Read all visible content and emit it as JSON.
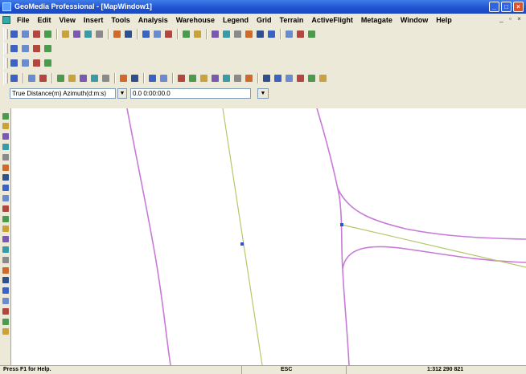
{
  "window": {
    "title": "GeoMedia Professional - [MapWindow1]",
    "controls": {
      "minimize": "_",
      "maximize": "□",
      "close": "×"
    }
  },
  "menu": {
    "items": [
      "File",
      "Edit",
      "View",
      "Insert",
      "Tools",
      "Analysis",
      "Warehouse",
      "Legend",
      "Grid",
      "Terrain",
      "ActiveFlight",
      "Metagate",
      "Window",
      "Help"
    ],
    "mdi_controls": {
      "minimize": "_",
      "restore": "▫",
      "close": "×"
    }
  },
  "measure": {
    "mode_value": "True Distance(m) Azimuth(d:m:s)",
    "coord_value": "0.0  0:00:00.0",
    "dropdown_arrow": "▼"
  },
  "status": {
    "help_text": "Press F1 for Help.",
    "esc_text": "ESC",
    "scale_text": "1:312 290 821"
  },
  "colors": {
    "road_purple": "#c77bd6",
    "line_yellow": "#b8c66a",
    "vertex_blue": "#2b55c8",
    "titlebar_blue": "#1e52d0"
  },
  "icons": {
    "toolbar_row1": [
      "new-icon",
      "open-icon",
      "save-icon",
      "print-icon",
      "cut-icon",
      "copy-icon",
      "paste-icon",
      "delete-icon",
      "undo-icon",
      "redo-icon",
      "select-tool-icon",
      "select-set-icon",
      "legend-icon",
      "layer-icon",
      "warehouse-icon",
      "zoom-in-icon",
      "zoom-out-icon",
      "fit-all-icon",
      "pan-icon",
      "refresh-icon",
      "overview-icon",
      "properties-icon",
      "magnifier-icon",
      "help-pointer-icon"
    ],
    "toolbar_row2": [
      "digitize-icon",
      "insert-icon",
      "edit-icon",
      "feature-icon"
    ],
    "toolbar_row3": [
      "grid-icon",
      "label-icon",
      "surface-icon",
      "tool-icon"
    ],
    "toolbar_row4": [
      "pointer-icon",
      "select-icon",
      "select-all-icon",
      "edit-geom-icon",
      "table-icon",
      "filter-icon",
      "analyze-icon",
      "measure-icon",
      "curve-icon",
      "trace-icon",
      "chart-icon",
      "snap-icon",
      "line-icon",
      "polyline-icon",
      "polygon-icon",
      "offset-icon",
      "arc-icon",
      "trim-icon",
      "extend-icon",
      "split-icon",
      "intersect-icon",
      "curve-fit-icon",
      "circle-icon",
      "point-icon",
      "rectangle-icon"
    ],
    "left_tools": [
      "line-tool-icon",
      "text-tool-icon",
      "rotate-icon",
      "scale-icon",
      "move-icon",
      "copy-feature-icon",
      "mirror-icon",
      "array-icon",
      "parallel-icon",
      "perpendicular-icon",
      "chamfer-icon",
      "fillet-icon",
      "merge-icon",
      "break-icon",
      "vertex-icon",
      "center-icon",
      "reverse-icon",
      "ellipse-icon",
      "spline-icon",
      "arrow-icon",
      "measure-distance-icon",
      "delete-tool-icon"
    ]
  }
}
